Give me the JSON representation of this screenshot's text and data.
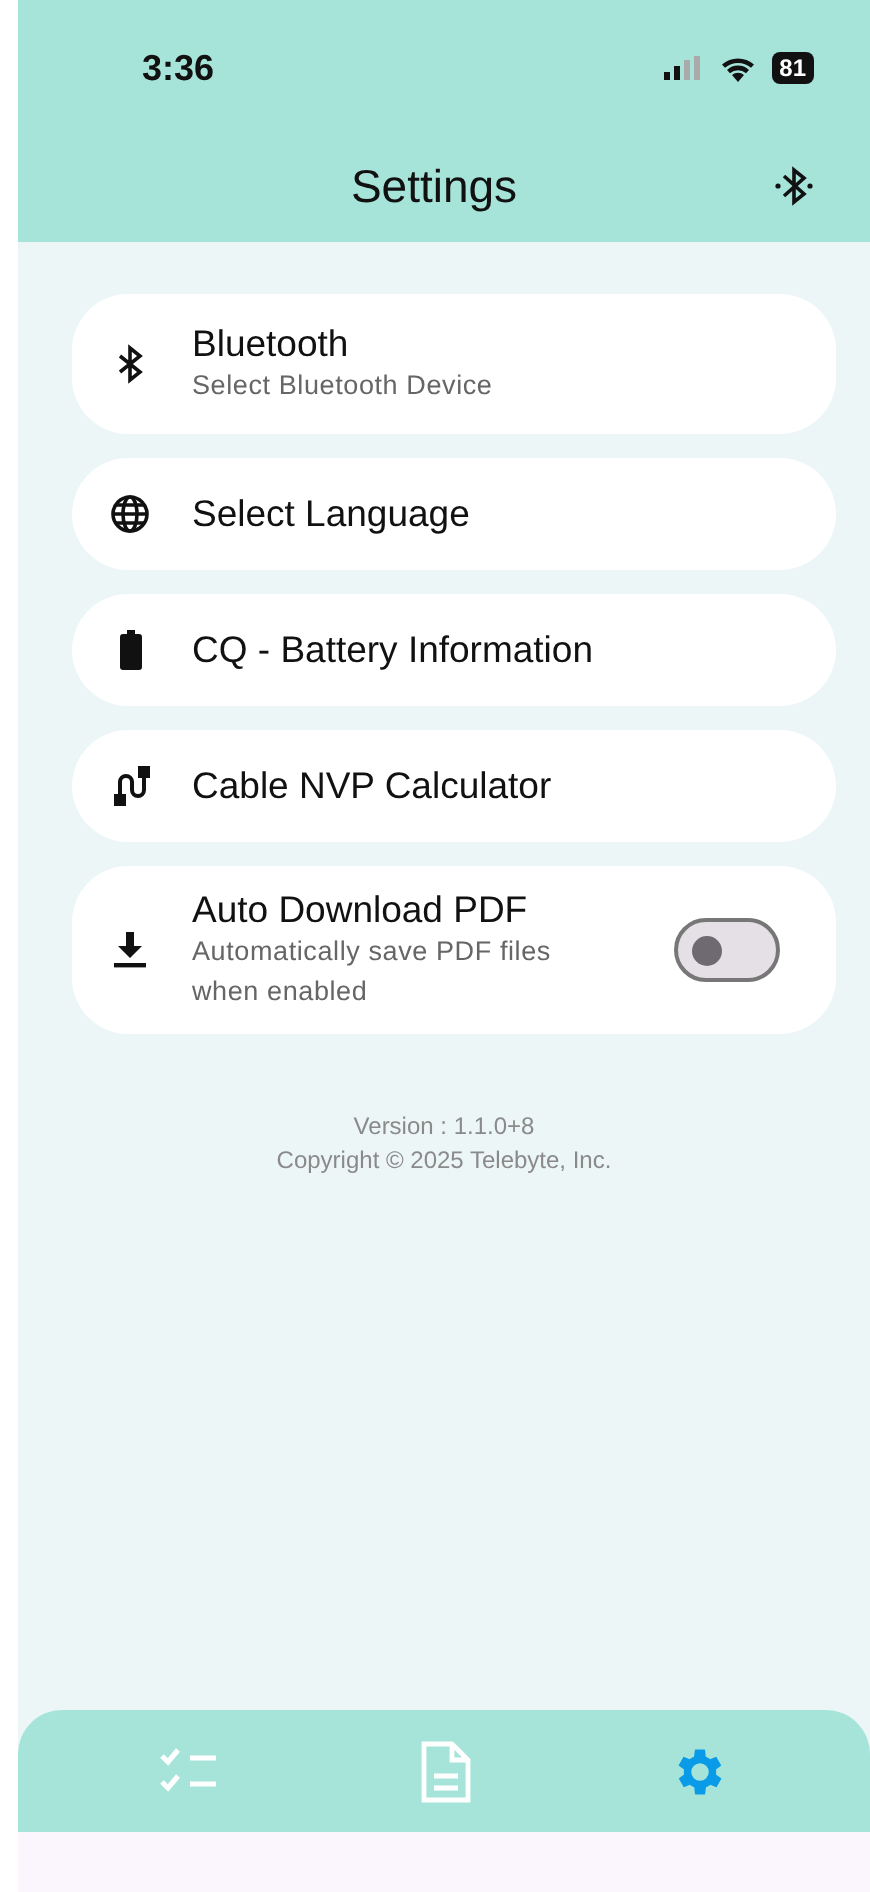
{
  "status_bar": {
    "time": "3:36",
    "battery": "81"
  },
  "header": {
    "title": "Settings"
  },
  "settings": [
    {
      "kind": "link",
      "title": "Bluetooth",
      "subtitle": "Select Bluetooth Device"
    },
    {
      "kind": "link",
      "title": "Select Language"
    },
    {
      "kind": "link",
      "title": "CQ - Battery Information"
    },
    {
      "kind": "link",
      "title": "Cable NVP Calculator"
    },
    {
      "kind": "toggle",
      "title": "Auto Download PDF",
      "subtitle": "Automatically save PDF files when enabled",
      "on": false
    }
  ],
  "footer": {
    "version": "Version : 1.1.0+8",
    "copyright": "Copyright © 2025 Telebyte, Inc."
  },
  "bottom_nav": [
    {
      "selected": false
    },
    {
      "selected": false
    },
    {
      "selected": true
    }
  ]
}
